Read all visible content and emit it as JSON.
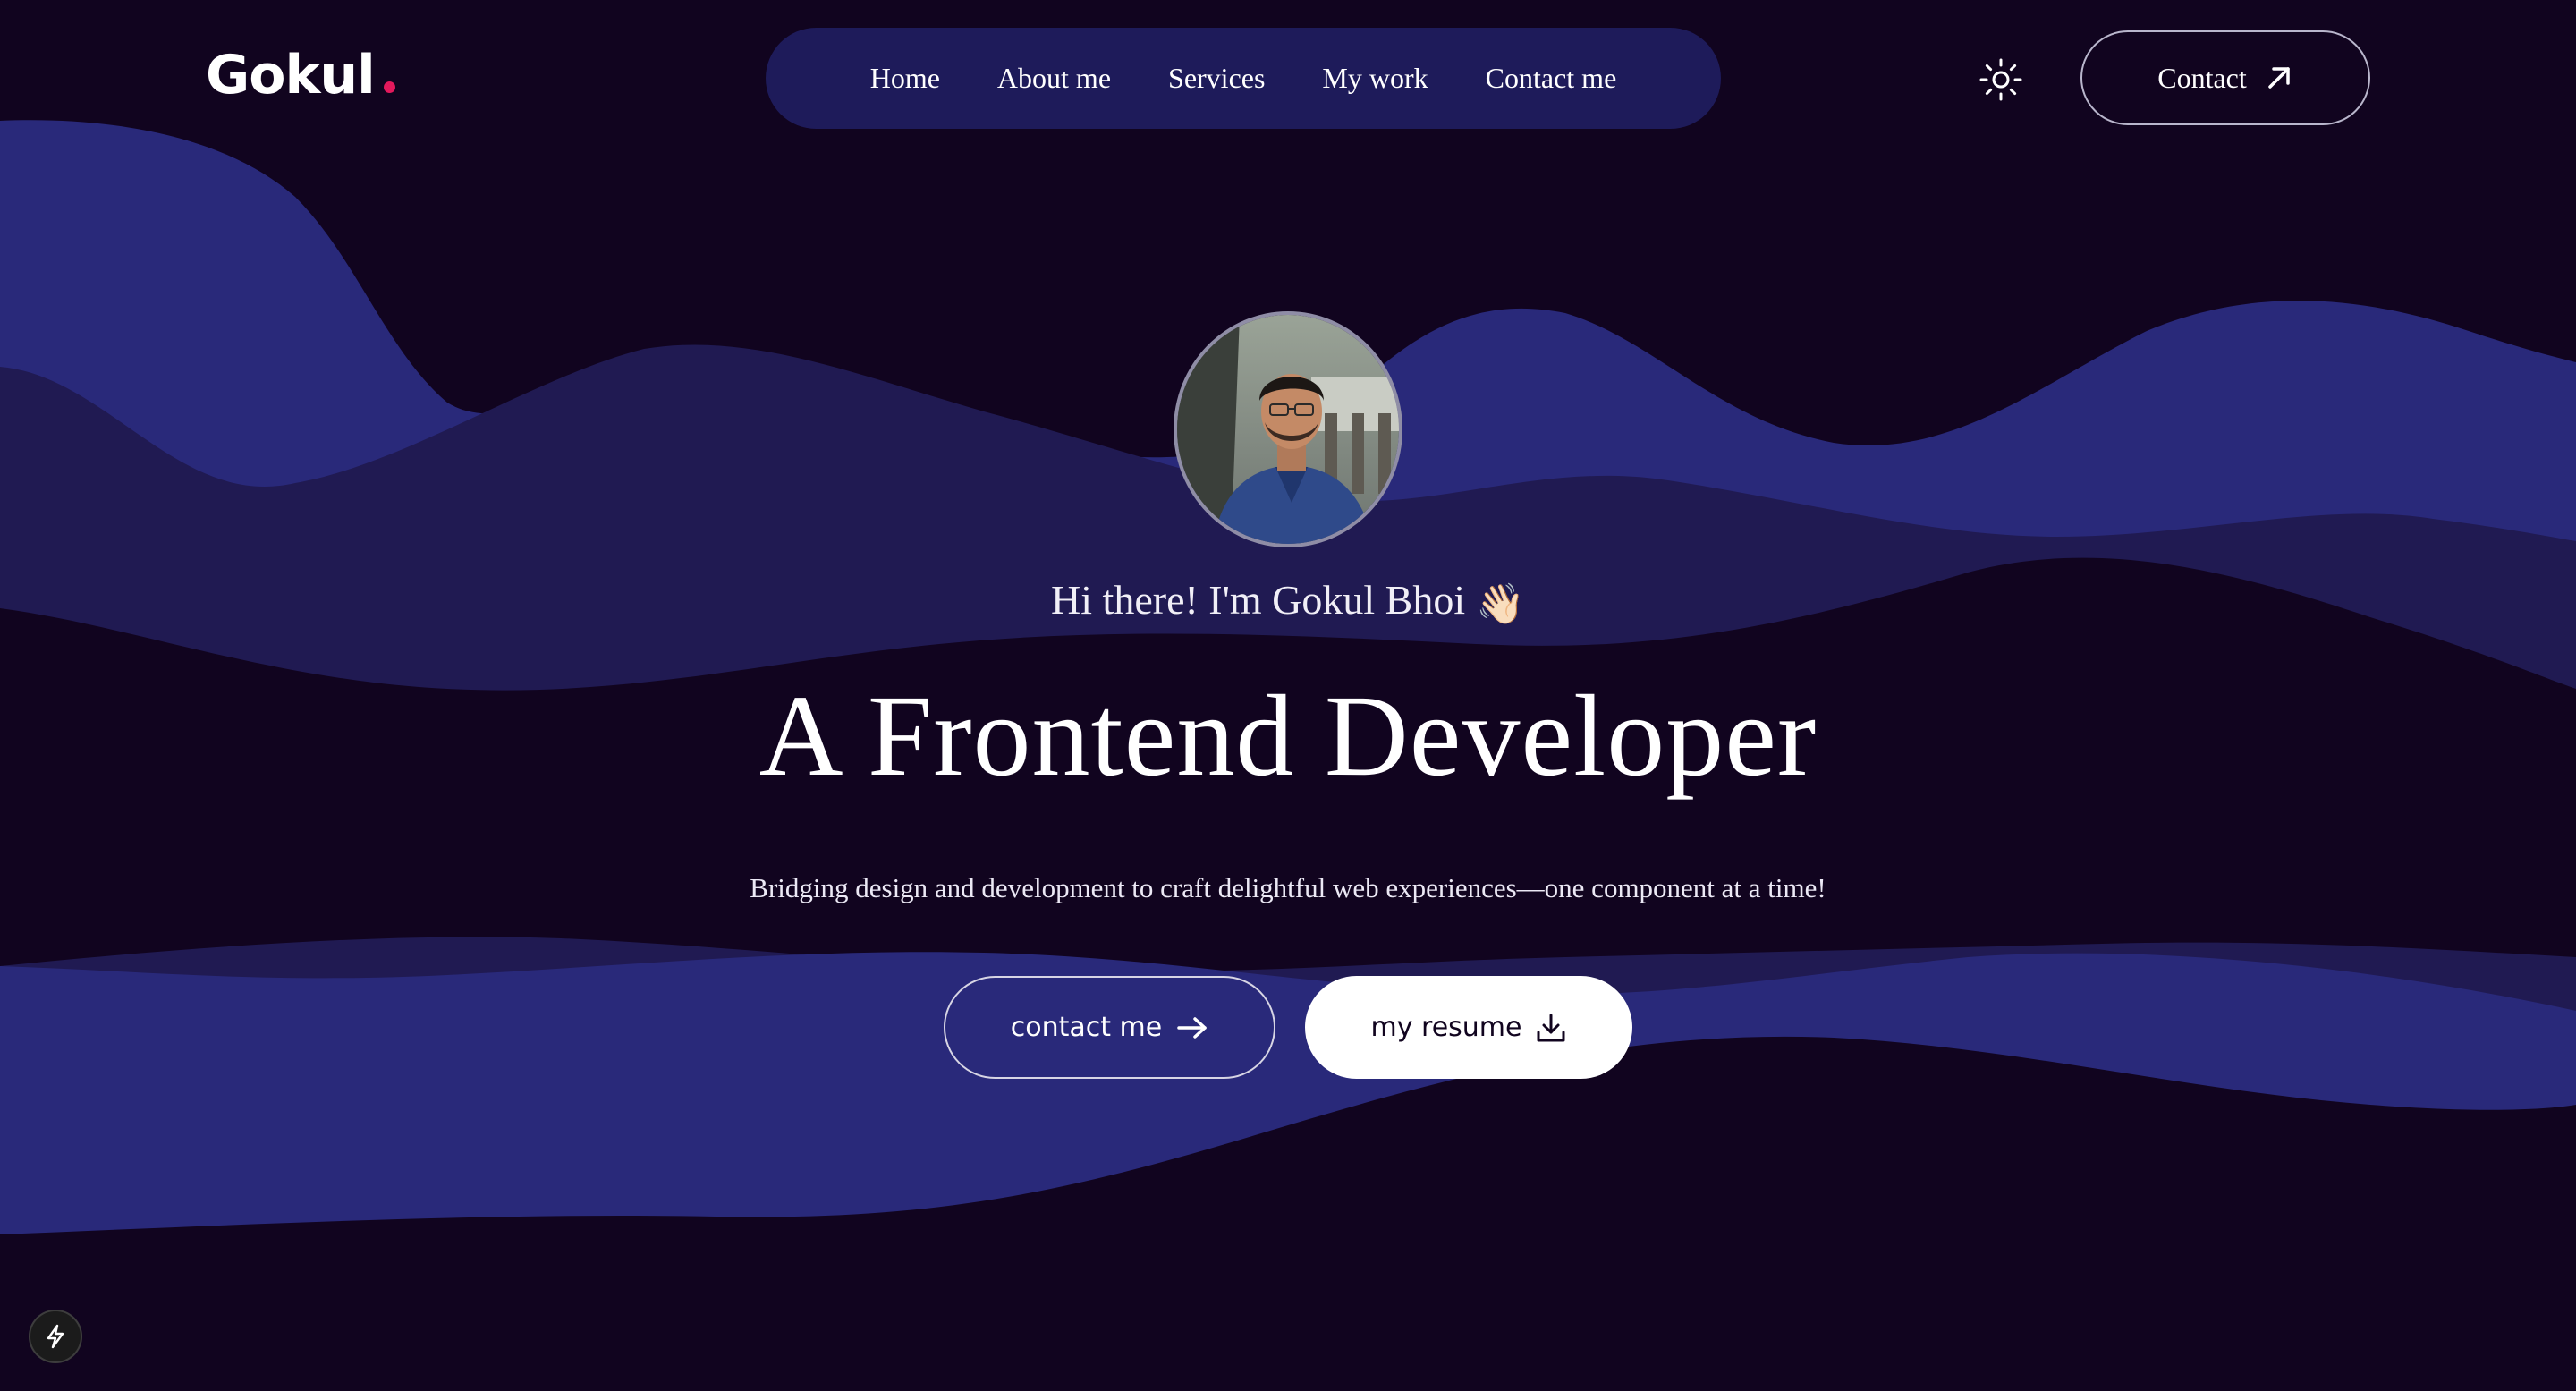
{
  "brand": {
    "logo_text": "Gokul",
    "accent_dot_color": "#e3195c"
  },
  "nav": {
    "items": [
      {
        "label": "Home"
      },
      {
        "label": "About me"
      },
      {
        "label": "Services"
      },
      {
        "label": "My work"
      },
      {
        "label": "Contact me"
      }
    ]
  },
  "header": {
    "theme_toggle_icon": "sun-icon",
    "contact_label": "Contact",
    "contact_icon": "arrow-up-right-icon"
  },
  "hero": {
    "avatar_icon": "profile-photo",
    "greeting": "Hi there! I'm Gokul Bhoi",
    "greeting_emoji": "👋🏻",
    "headline": "A Frontend Developer",
    "tagline": "Bridging design and development to craft delightful web experiences—one component at a time!",
    "cta_primary_label": "contact me",
    "cta_primary_icon": "arrow-right-icon",
    "cta_secondary_label": "my resume",
    "cta_secondary_icon": "download-icon"
  },
  "footer": {
    "dev_badge_icon": "lightning-icon"
  },
  "colors": {
    "background": "#11041f",
    "wave_light": "#29297a",
    "wave_dark": "#201a52",
    "nav_pill": "#1e1b5a",
    "text": "#ffffff"
  }
}
